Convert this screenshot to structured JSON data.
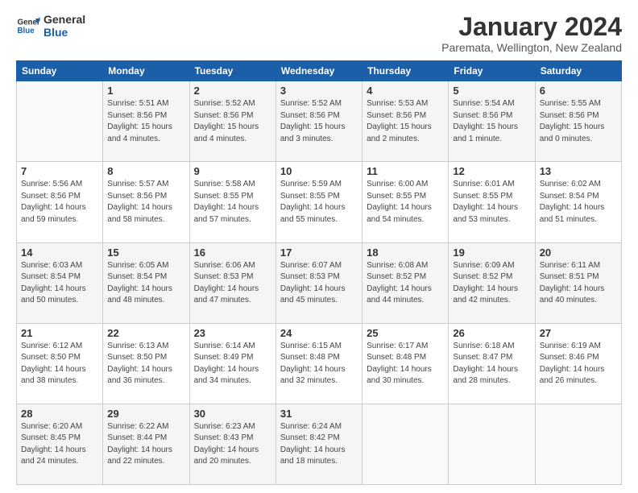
{
  "logo": {
    "text_general": "General",
    "text_blue": "Blue"
  },
  "header": {
    "month": "January 2024",
    "location": "Paremata, Wellington, New Zealand"
  },
  "days_of_week": [
    "Sunday",
    "Monday",
    "Tuesday",
    "Wednesday",
    "Thursday",
    "Friday",
    "Saturday"
  ],
  "weeks": [
    [
      {
        "date": "",
        "info": ""
      },
      {
        "date": "1",
        "info": "Sunrise: 5:51 AM\nSunset: 8:56 PM\nDaylight: 15 hours\nand 4 minutes."
      },
      {
        "date": "2",
        "info": "Sunrise: 5:52 AM\nSunset: 8:56 PM\nDaylight: 15 hours\nand 4 minutes."
      },
      {
        "date": "3",
        "info": "Sunrise: 5:52 AM\nSunset: 8:56 PM\nDaylight: 15 hours\nand 3 minutes."
      },
      {
        "date": "4",
        "info": "Sunrise: 5:53 AM\nSunset: 8:56 PM\nDaylight: 15 hours\nand 2 minutes."
      },
      {
        "date": "5",
        "info": "Sunrise: 5:54 AM\nSunset: 8:56 PM\nDaylight: 15 hours\nand 1 minute."
      },
      {
        "date": "6",
        "info": "Sunrise: 5:55 AM\nSunset: 8:56 PM\nDaylight: 15 hours\nand 0 minutes."
      }
    ],
    [
      {
        "date": "7",
        "info": "Sunrise: 5:56 AM\nSunset: 8:56 PM\nDaylight: 14 hours\nand 59 minutes."
      },
      {
        "date": "8",
        "info": "Sunrise: 5:57 AM\nSunset: 8:56 PM\nDaylight: 14 hours\nand 58 minutes."
      },
      {
        "date": "9",
        "info": "Sunrise: 5:58 AM\nSunset: 8:55 PM\nDaylight: 14 hours\nand 57 minutes."
      },
      {
        "date": "10",
        "info": "Sunrise: 5:59 AM\nSunset: 8:55 PM\nDaylight: 14 hours\nand 55 minutes."
      },
      {
        "date": "11",
        "info": "Sunrise: 6:00 AM\nSunset: 8:55 PM\nDaylight: 14 hours\nand 54 minutes."
      },
      {
        "date": "12",
        "info": "Sunrise: 6:01 AM\nSunset: 8:55 PM\nDaylight: 14 hours\nand 53 minutes."
      },
      {
        "date": "13",
        "info": "Sunrise: 6:02 AM\nSunset: 8:54 PM\nDaylight: 14 hours\nand 51 minutes."
      }
    ],
    [
      {
        "date": "14",
        "info": "Sunrise: 6:03 AM\nSunset: 8:54 PM\nDaylight: 14 hours\nand 50 minutes."
      },
      {
        "date": "15",
        "info": "Sunrise: 6:05 AM\nSunset: 8:54 PM\nDaylight: 14 hours\nand 48 minutes."
      },
      {
        "date": "16",
        "info": "Sunrise: 6:06 AM\nSunset: 8:53 PM\nDaylight: 14 hours\nand 47 minutes."
      },
      {
        "date": "17",
        "info": "Sunrise: 6:07 AM\nSunset: 8:53 PM\nDaylight: 14 hours\nand 45 minutes."
      },
      {
        "date": "18",
        "info": "Sunrise: 6:08 AM\nSunset: 8:52 PM\nDaylight: 14 hours\nand 44 minutes."
      },
      {
        "date": "19",
        "info": "Sunrise: 6:09 AM\nSunset: 8:52 PM\nDaylight: 14 hours\nand 42 minutes."
      },
      {
        "date": "20",
        "info": "Sunrise: 6:11 AM\nSunset: 8:51 PM\nDaylight: 14 hours\nand 40 minutes."
      }
    ],
    [
      {
        "date": "21",
        "info": "Sunrise: 6:12 AM\nSunset: 8:50 PM\nDaylight: 14 hours\nand 38 minutes."
      },
      {
        "date": "22",
        "info": "Sunrise: 6:13 AM\nSunset: 8:50 PM\nDaylight: 14 hours\nand 36 minutes."
      },
      {
        "date": "23",
        "info": "Sunrise: 6:14 AM\nSunset: 8:49 PM\nDaylight: 14 hours\nand 34 minutes."
      },
      {
        "date": "24",
        "info": "Sunrise: 6:15 AM\nSunset: 8:48 PM\nDaylight: 14 hours\nand 32 minutes."
      },
      {
        "date": "25",
        "info": "Sunrise: 6:17 AM\nSunset: 8:48 PM\nDaylight: 14 hours\nand 30 minutes."
      },
      {
        "date": "26",
        "info": "Sunrise: 6:18 AM\nSunset: 8:47 PM\nDaylight: 14 hours\nand 28 minutes."
      },
      {
        "date": "27",
        "info": "Sunrise: 6:19 AM\nSunset: 8:46 PM\nDaylight: 14 hours\nand 26 minutes."
      }
    ],
    [
      {
        "date": "28",
        "info": "Sunrise: 6:20 AM\nSunset: 8:45 PM\nDaylight: 14 hours\nand 24 minutes."
      },
      {
        "date": "29",
        "info": "Sunrise: 6:22 AM\nSunset: 8:44 PM\nDaylight: 14 hours\nand 22 minutes."
      },
      {
        "date": "30",
        "info": "Sunrise: 6:23 AM\nSunset: 8:43 PM\nDaylight: 14 hours\nand 20 minutes."
      },
      {
        "date": "31",
        "info": "Sunrise: 6:24 AM\nSunset: 8:42 PM\nDaylight: 14 hours\nand 18 minutes."
      },
      {
        "date": "",
        "info": ""
      },
      {
        "date": "",
        "info": ""
      },
      {
        "date": "",
        "info": ""
      }
    ]
  ]
}
